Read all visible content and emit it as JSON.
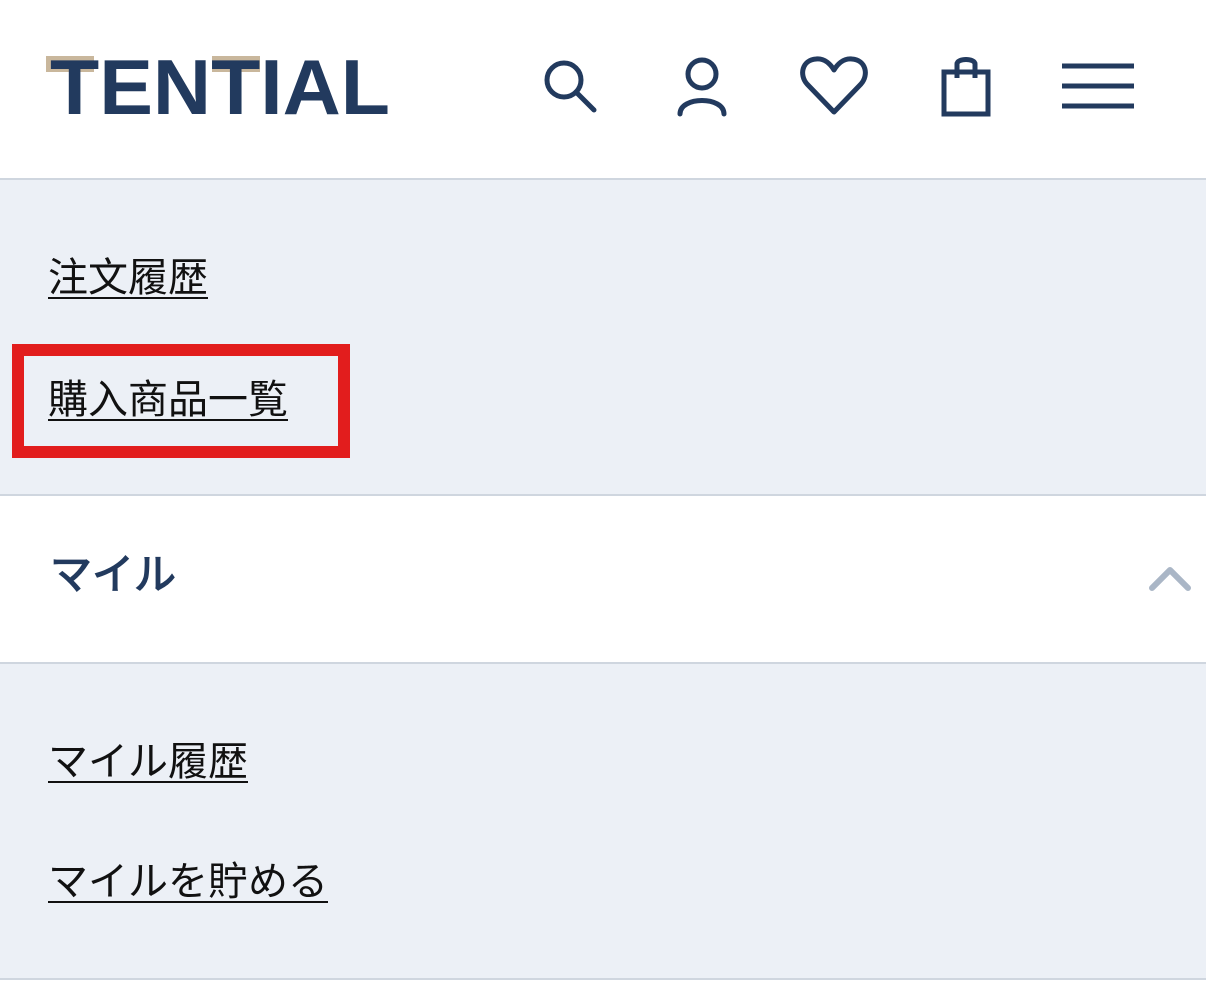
{
  "header": {
    "logo_text": "TENTIAL",
    "icons": [
      "search-icon",
      "user-icon",
      "heart-icon",
      "bag-icon",
      "menu-icon"
    ]
  },
  "order_section": {
    "links": [
      "注文履歴",
      "購入商品一覧"
    ],
    "highlighted": "購入商品一覧"
  },
  "mile_section": {
    "title": "マイル",
    "state": "expanded",
    "links": [
      "マイル履歴",
      "マイルを貯める"
    ]
  },
  "colors": {
    "brand_navy": "#223a5e",
    "brand_tan": "#c9b79c",
    "panel_bg": "#ecf0f6",
    "highlight_red": "#e21d1d",
    "chevron_gray": "#aab6c6"
  }
}
